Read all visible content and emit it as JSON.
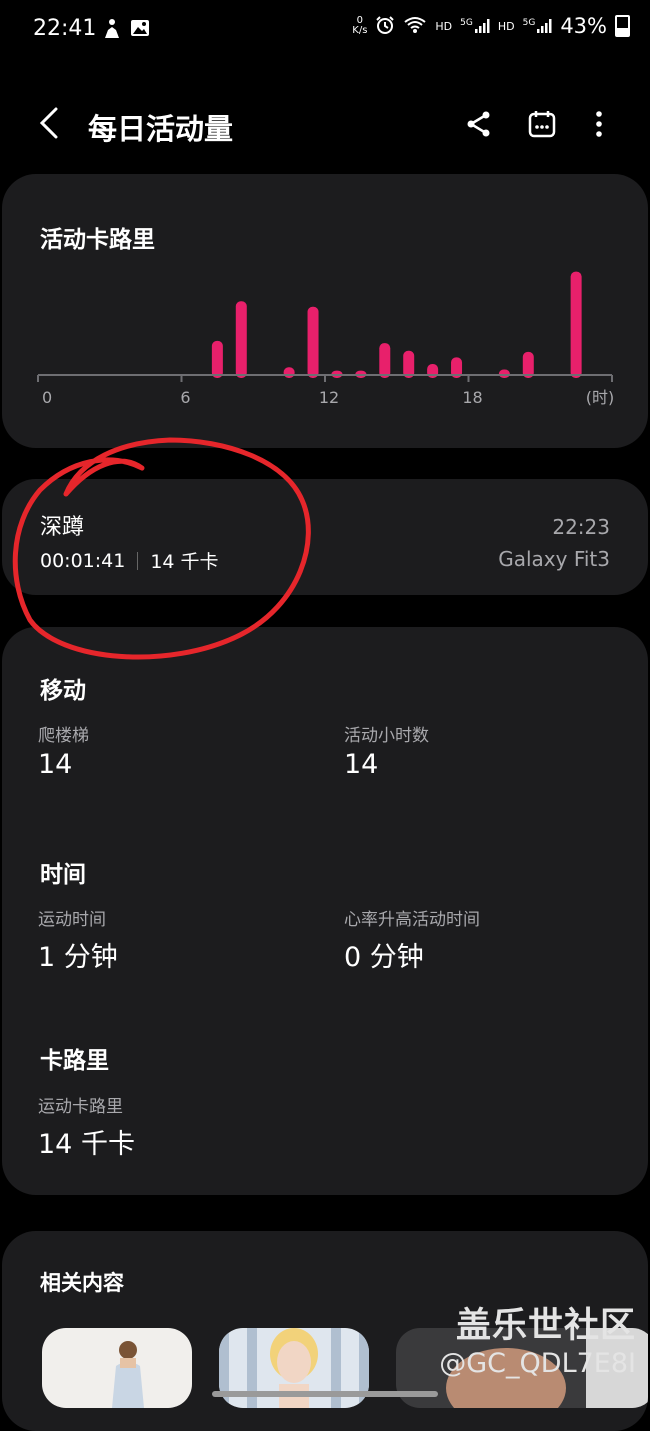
{
  "status_bar": {
    "time": "22:41",
    "net_speed_value": "0",
    "net_speed_unit": "K/s",
    "hd1": "HD",
    "net1": "5G",
    "hd2": "HD",
    "net2": "5G",
    "battery": "43%"
  },
  "header": {
    "title": "每日活动量",
    "back_icon": "back-chevron",
    "share_icon": "share",
    "calendar_icon": "calendar",
    "more_icon": "more-vertical"
  },
  "chart_card": {
    "title": "活动卡路里"
  },
  "chart_data": {
    "type": "bar",
    "title": "活动卡路里",
    "x_unit_label": "(时)",
    "x_ticks": [
      "0",
      "6",
      "12",
      "18"
    ],
    "xlim": [
      0,
      24
    ],
    "hours": [
      7,
      8,
      10,
      11,
      12,
      13,
      14,
      15,
      16,
      17,
      19,
      20,
      22
    ],
    "values": [
      31,
      67,
      7,
      62,
      4,
      4,
      29,
      22,
      10,
      16,
      5,
      21,
      94
    ],
    "bar_color": "#e8206b",
    "axis_color": "#6e6e72"
  },
  "workout_card": {
    "name": "深蹲",
    "duration": "00:01:41",
    "calories": "14 千卡",
    "time": "22:23",
    "device": "Galaxy Fit3"
  },
  "stats_card": {
    "move_title": "移动",
    "floors_label": "爬楼梯",
    "floors_value": "14",
    "active_hours_label": "活动小时数",
    "active_hours_value": "14",
    "time_title": "时间",
    "exercise_time_label": "运动时间",
    "exercise_time_value": "1 分钟",
    "hr_time_label": "心率升高活动时间",
    "hr_time_value": "0 分钟",
    "calories_title": "卡路里",
    "exercise_cal_label": "运动卡路里",
    "exercise_cal_value": "14 千卡"
  },
  "related": {
    "title": "相关内容"
  },
  "watermark": {
    "line1": "盖乐世社区",
    "line2": "@GC_QDL7E8I"
  },
  "colors": {
    "background": "#000000",
    "card": "#1c1c1e",
    "accent_pink": "#e8206b",
    "annotation_red": "#e6262b",
    "secondary_text": "#a8a8ac"
  }
}
